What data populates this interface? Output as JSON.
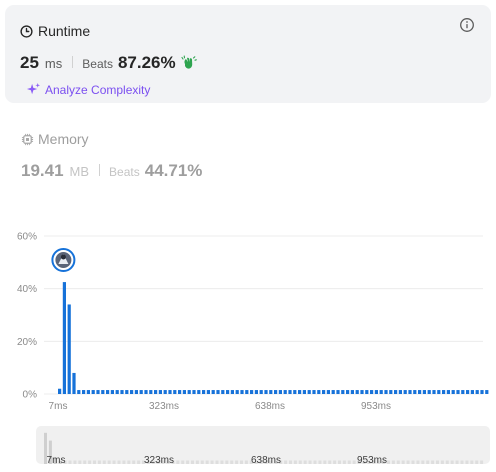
{
  "runtime": {
    "title": "Runtime",
    "value": "25",
    "unit": "ms",
    "beats_label": "Beats",
    "beats_value": "87.26%",
    "analyze_label": "Analyze Complexity",
    "icons": [
      "clock-icon",
      "info-icon",
      "clap-icon",
      "sparkle-icon"
    ]
  },
  "memory": {
    "title": "Memory",
    "value": "19.41",
    "unit": "MB",
    "beats_label": "Beats",
    "beats_value": "44.71%",
    "icons": [
      "chip-icon"
    ]
  },
  "colors": {
    "accent_bar": "#1672d9",
    "analyze_purple": "#7b4ff0",
    "card_bg": "#f2f3f5",
    "muted_text": "#9e9e9e"
  },
  "chart_data": {
    "type": "bar",
    "xlabel": "",
    "ylabel": "",
    "ylim": [
      0,
      60
    ],
    "y_ticks": [
      "0%",
      "20%",
      "40%",
      "60%"
    ],
    "x_ticks": [
      "7ms",
      "323ms",
      "638ms",
      "953ms"
    ],
    "grid": true,
    "values": [
      2,
      42.5,
      34,
      8,
      1.5,
      1.5,
      1.5,
      1.5,
      1.5,
      1.5,
      1.5,
      1.5,
      1.5,
      1.5,
      1.5,
      1.5,
      1.5,
      1.5,
      1.5,
      1.5,
      1.5,
      1.5,
      1.5,
      1.5,
      1.5,
      1.5,
      1.5,
      1.5,
      1.5,
      1.5,
      1.5,
      1.5,
      1.5,
      1.5,
      1.5,
      1.5,
      1.5,
      1.5,
      1.5,
      1.5,
      1.5,
      1.5,
      1.5,
      1.5,
      1.5,
      1.5,
      1.5,
      1.5,
      1.5,
      1.5,
      1.5,
      1.5,
      1.5,
      1.5,
      1.5,
      1.5,
      1.5,
      1.5,
      1.5,
      1.5,
      1.5,
      1.5,
      1.5,
      1.5,
      1.5,
      1.5,
      1.5,
      1.5,
      1.5,
      1.5,
      1.5,
      1.5,
      1.5,
      1.5,
      1.5,
      1.5,
      1.5,
      1.5,
      1.5,
      1.5,
      1.5,
      1.5,
      1.5,
      1.5,
      1.5,
      1.5,
      1.5,
      1.5,
      1.5,
      1.5
    ],
    "highlight_index": 1,
    "mini_x_ticks": [
      "7ms",
      "323ms",
      "638ms",
      "953ms"
    ]
  }
}
